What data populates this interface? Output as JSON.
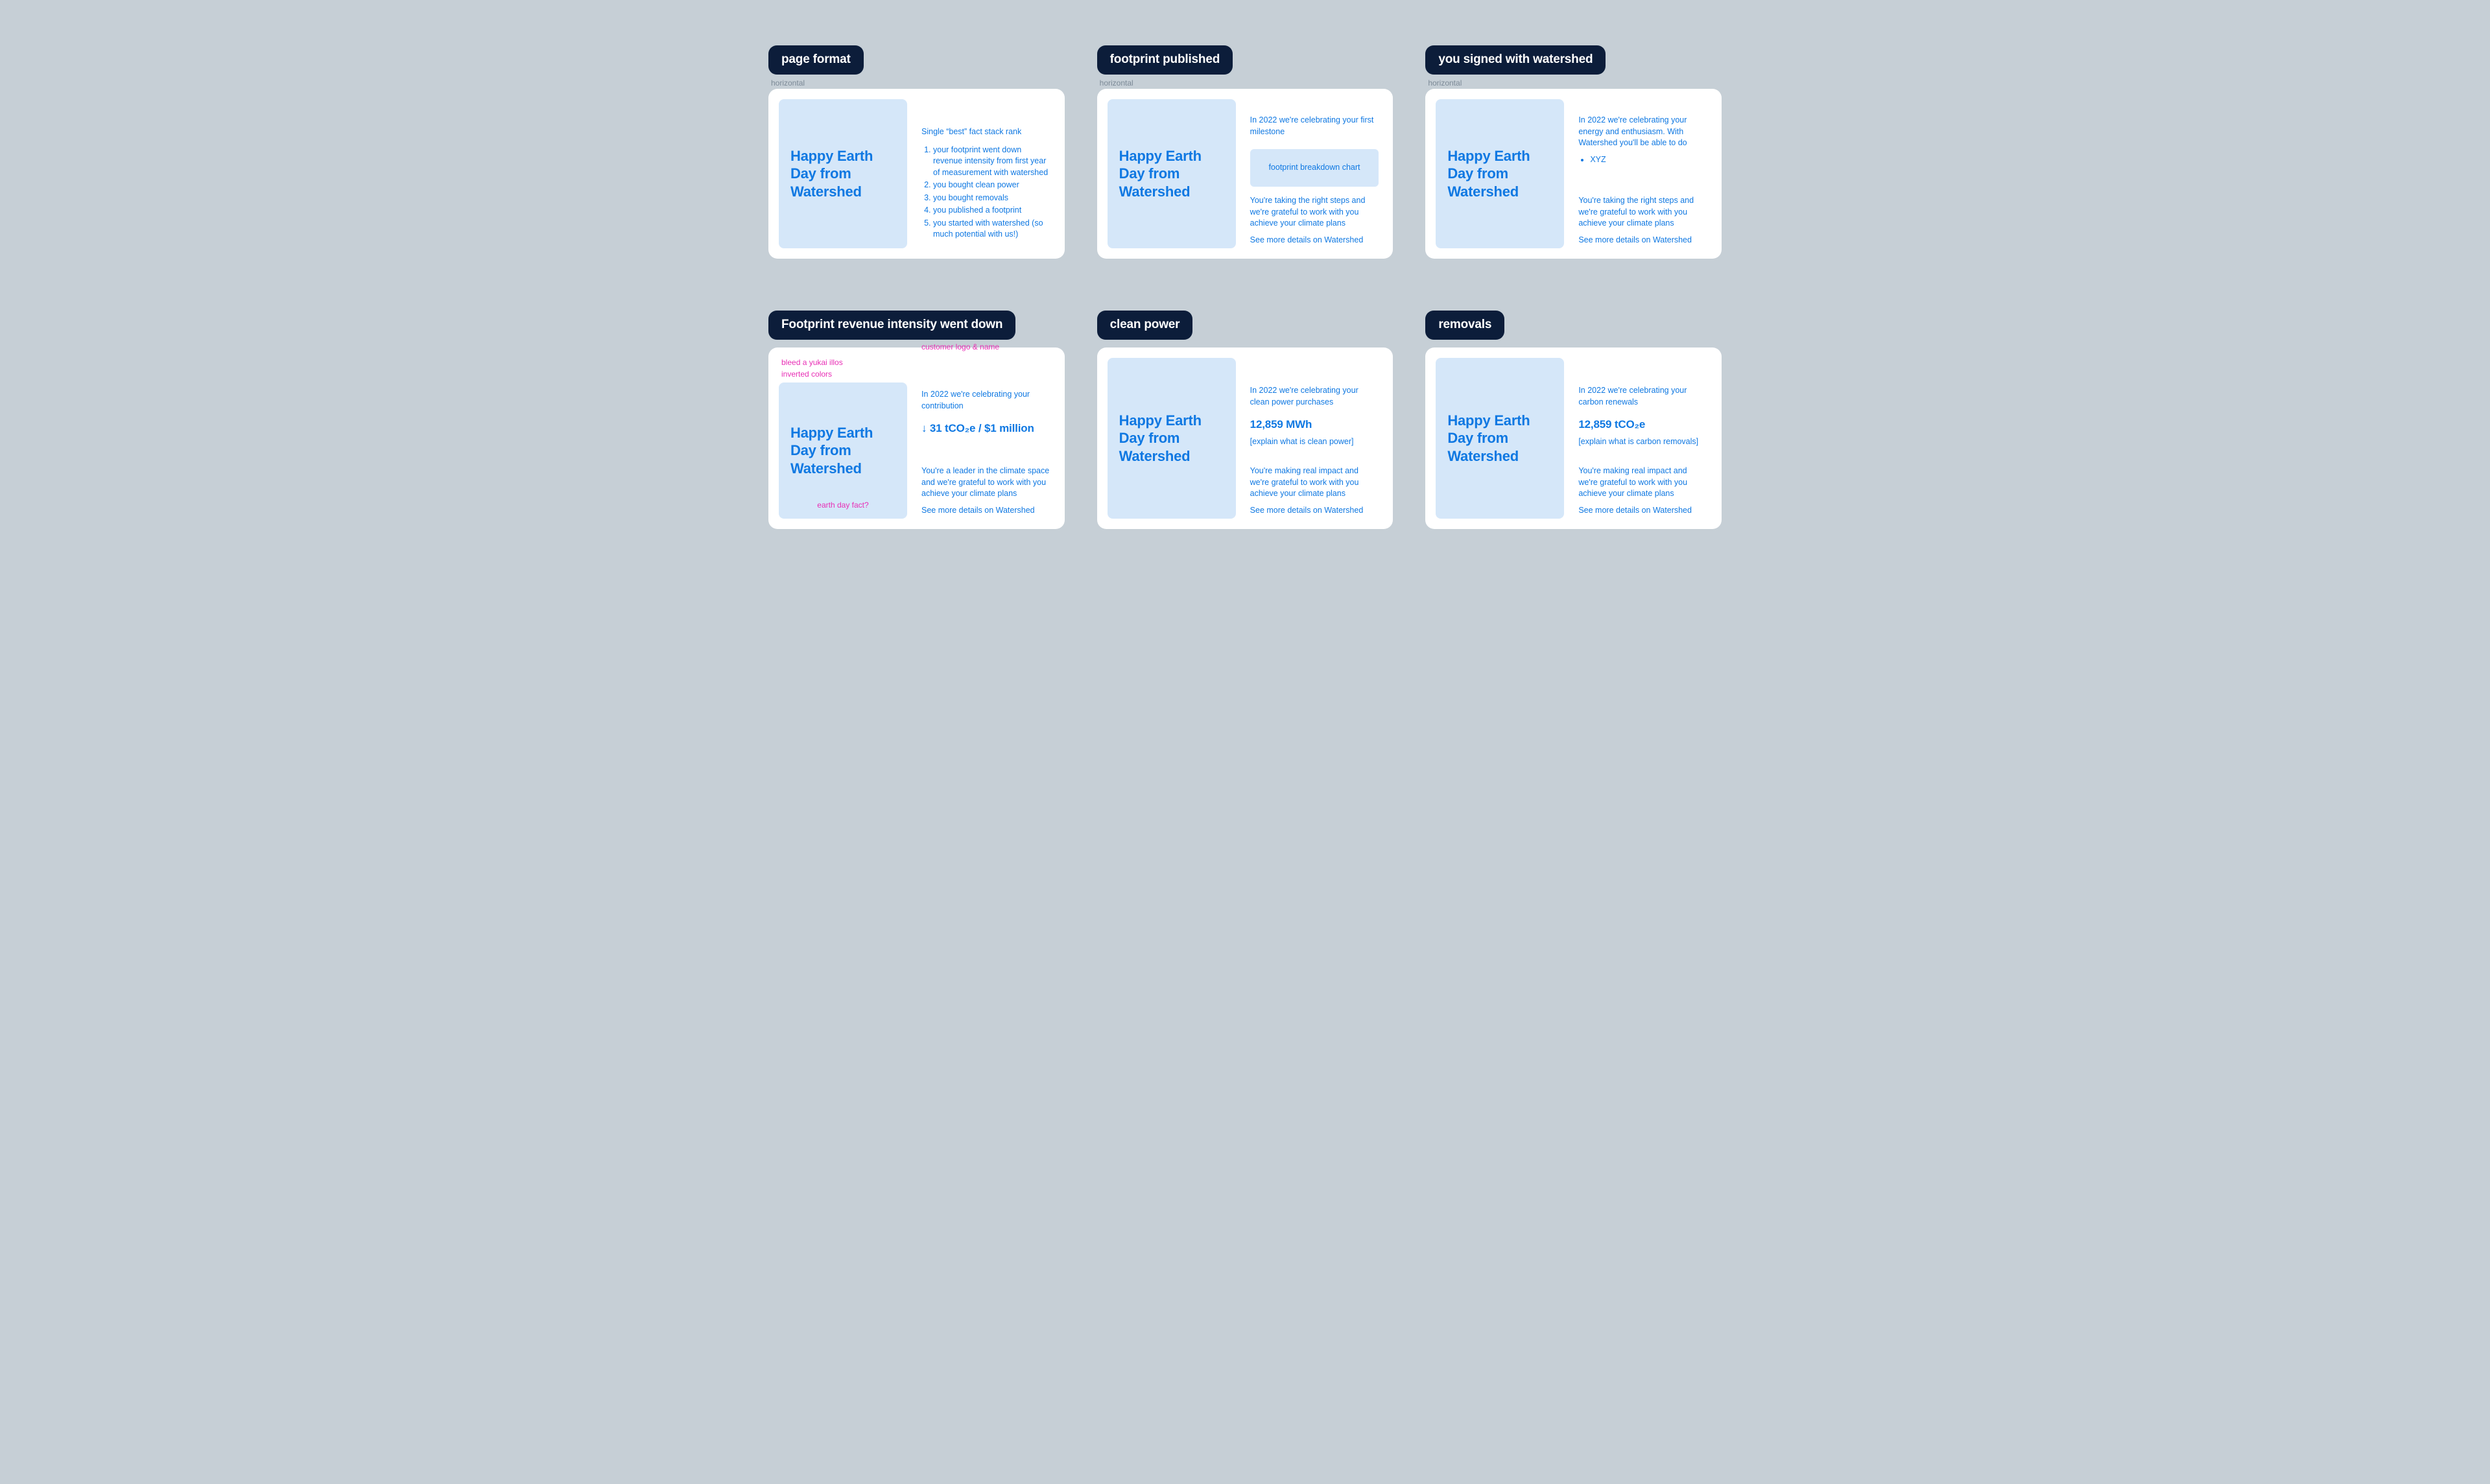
{
  "hero_title": "Happy Earth Day from Watershed",
  "sublabel": "horizontal",
  "frames": {
    "page_format": {
      "chip": "page format",
      "rank_intro": "Single “best” fact stack rank",
      "ranks": [
        "your footprint went down revenue intensity from first year of measurement with watershed",
        "you bought clean power",
        "you bought removals",
        "you published a footprint",
        "you started with watershed (so much potential with us!)"
      ]
    },
    "footprint_published": {
      "chip": "footprint published",
      "intro": "In 2022 we're celebrating your first milestone",
      "chart_label": "footprint breakdown chart",
      "closing": "You're taking the right steps and we're grateful to work with you achieve your climate plans",
      "link": "See more details on Watershed"
    },
    "signed": {
      "chip": "you signed with watershed",
      "intro": "In 2022 we're celebrating your energy and enthusiasm. With Watershed you'll be able to do",
      "bullets": [
        "XYZ"
      ],
      "closing": "You're taking the right steps and we're grateful to work with you achieve your climate plans",
      "link": "See more details on Watershed"
    },
    "intensity": {
      "chip": "Footprint revenue intensity went down",
      "note_bleed": "bleed a yukai illos",
      "note_inverted": "inverted colors",
      "note_logo": "customer logo & name",
      "note_fact": "earth day fact?",
      "intro": "In 2022 we're celebrating your contribution",
      "stat": "↓ 31 tCO₂e / $1 million",
      "closing": "You're a leader in the climate space and we're grateful to work with you achieve your climate plans",
      "link": "See more details on Watershed"
    },
    "clean_power": {
      "chip": "clean power",
      "intro": "In 2022 we're celebrating your clean power purchases",
      "stat": "12,859 MWh",
      "explain": "[explain what is clean power]",
      "closing": "You're making real impact and we're grateful to work with you achieve your climate plans",
      "link": "See more details on Watershed"
    },
    "removals": {
      "chip": "removals",
      "intro": "In 2022 we're celebrating your carbon renewals",
      "stat": "12,859 tCO₂e",
      "explain": "[explain what is carbon removals]",
      "closing": "You're making real impact and we're grateful to work with you achieve your climate plans",
      "link": "See more details on Watershed"
    }
  }
}
